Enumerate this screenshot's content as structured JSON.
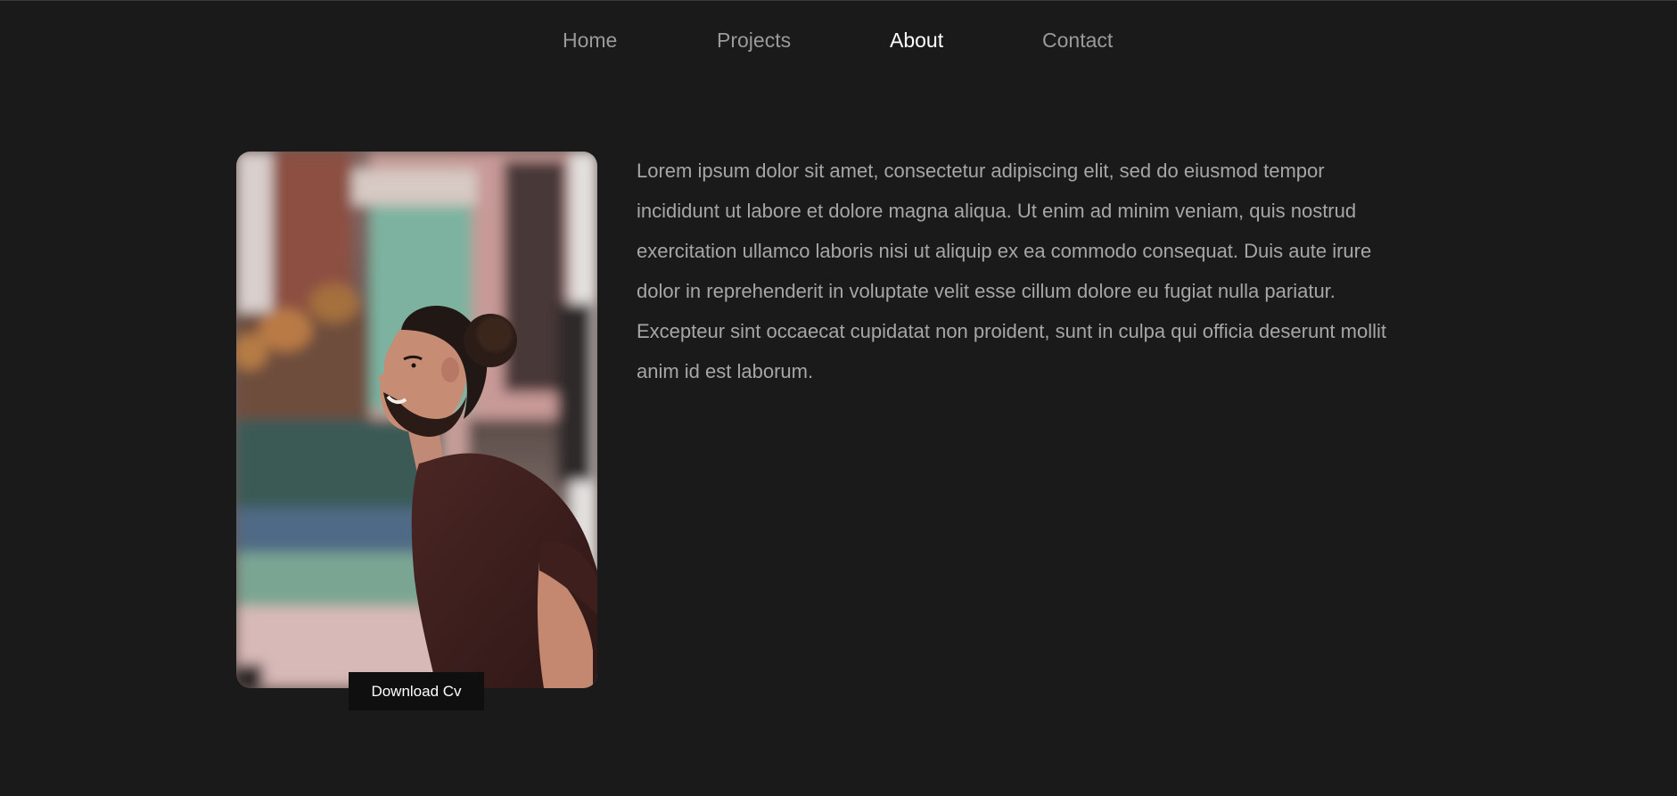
{
  "nav": {
    "items": [
      {
        "label": "Home",
        "active": false
      },
      {
        "label": "Projects",
        "active": false
      },
      {
        "label": "About",
        "active": true
      },
      {
        "label": "Contact",
        "active": false
      }
    ]
  },
  "about": {
    "lines": [
      "Lorem ipsum dolor sit amet, consectetur adipiscing elit, sed do eiusmod tempor",
      "incididunt ut labore et dolore magna aliqua. Ut enim ad minim veniam, quis nostrud",
      "exercitation ullamco laboris nisi ut aliquip ex ea commodo consequat. Duis aute irure",
      "dolor in reprehenderit in voluptate velit esse cillum dolore eu fugiat nulla pariatur.",
      "Excepteur sint occaecat cupidatat non proident, sunt in culpa qui officia deserunt mollit",
      "anim id est laborum."
    ],
    "download_label": "Download Cv"
  },
  "colors": {
    "background": "#1a1a1a",
    "nav_text": "#9a9a9a",
    "nav_active": "#ffffff",
    "body_text": "#a6a6a6",
    "button_bg": "#0f0f0f",
    "button_text": "#ffffff"
  }
}
